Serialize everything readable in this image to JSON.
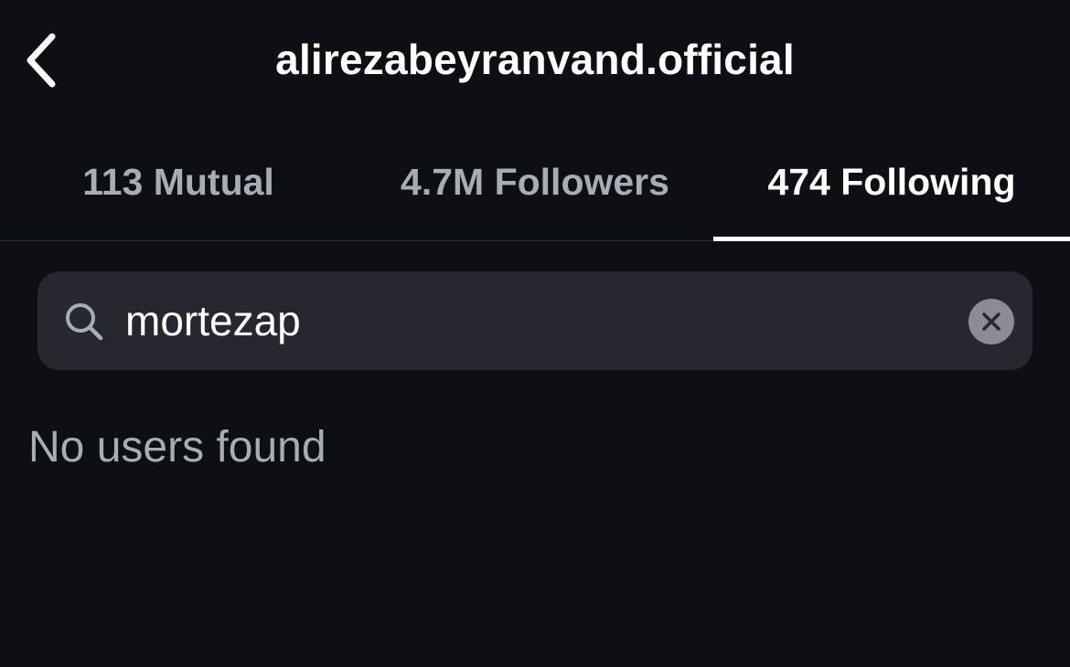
{
  "header": {
    "title": "alirezabeyranvand.official",
    "back_icon": "chevron-left-icon"
  },
  "tabs": [
    {
      "label": "113 Mutual",
      "active": false
    },
    {
      "label": "4.7M Followers",
      "active": false
    },
    {
      "label": "474 Following",
      "active": true
    }
  ],
  "search": {
    "value": "mortezap",
    "icon": "search-icon",
    "clear_icon": "clear-icon"
  },
  "results": {
    "empty_message": "No users found"
  },
  "colors": {
    "background": "#0c0f14",
    "search_background": "#25282e",
    "active_text": "#ffffff",
    "inactive_text": "#a8acb3"
  }
}
